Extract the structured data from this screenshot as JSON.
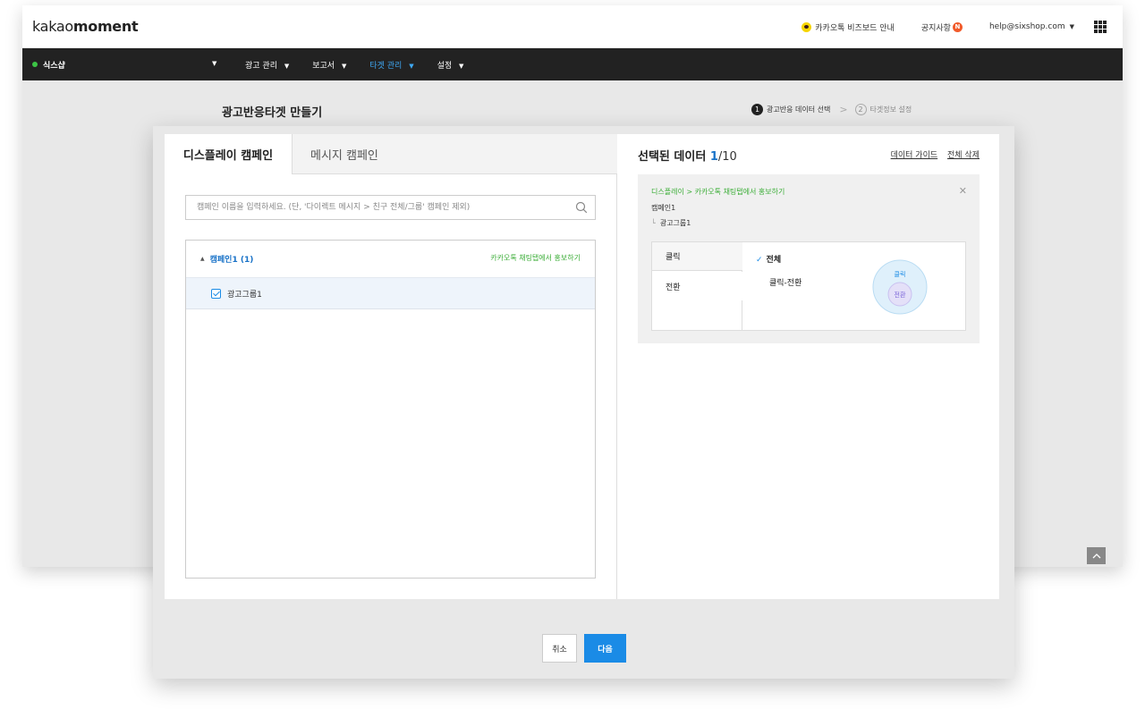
{
  "topbar": {
    "logo_light": "kakao",
    "logo_bold": "moment",
    "guide": "카카오톡 비즈보드 안내",
    "notice": "공지사항",
    "notice_badge": "N",
    "email": "help@sixshop.com"
  },
  "nav": {
    "shop": "식스샵",
    "menu": [
      "광고 관리",
      "보고서",
      "타겟 관리",
      "설정"
    ],
    "active_index": 2
  },
  "page": {
    "title": "광고반응타겟 만들기",
    "steps": [
      {
        "num": "1",
        "label": "광고반응 데이터 선택"
      },
      {
        "num": "2",
        "label": "타겟정보 설정"
      }
    ]
  },
  "tabs": [
    "디스플레이 캠페인",
    "메시지 캠페인"
  ],
  "search": {
    "placeholder": "캠페인 이름을 입력하세요. (단, '다이렉트 메시지 > 친구 전체/그룹' 캠페인 제외)"
  },
  "campaigns": [
    {
      "name": "캠페인1 (1)",
      "placement": "카카오톡 채팅탭에서 홍보하기",
      "groups": [
        "광고그룹1"
      ]
    }
  ],
  "selected": {
    "title": "선택된 데이터 ",
    "count": "1",
    "total": "/10",
    "guide_link": "데이터 가이드",
    "delete_all": "전체 삭제",
    "item": {
      "path": "디스플레이 > 카카오톡 채팅탭에서 홍보하기",
      "campaign": "캠페인1",
      "corner": "└",
      "group": "광고그룹1",
      "options": [
        "클릭",
        "전환"
      ],
      "sub_options": [
        "전체",
        "클릭-전환"
      ],
      "venn_outer": "클릭",
      "venn_inner": "전환"
    }
  },
  "buttons": {
    "cancel": "취소",
    "next": "다음"
  },
  "colors": {
    "accent": "#1a8be6",
    "link_blue": "#1a73c8",
    "green": "#3cae38",
    "nav_bg": "#222222"
  }
}
